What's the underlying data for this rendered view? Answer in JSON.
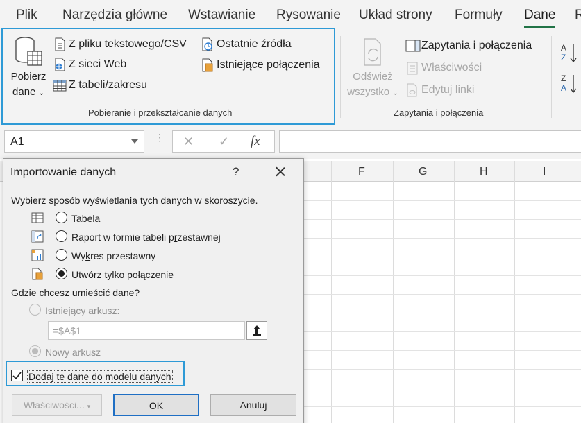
{
  "ribbon": {
    "tabs": [
      "Plik",
      "Narzędzia główne",
      "Wstawianie",
      "Rysowanie",
      "Układ strony",
      "Formuły",
      "Dane",
      "R"
    ],
    "active_tab": "Dane",
    "get_data_label_line1": "Pobierz",
    "get_data_label_line2": "dane",
    "get_group": {
      "items": [
        "Z pliku tekstowego/CSV",
        "Z sieci Web",
        "Z tabeli/zakresu",
        "Ostatnie źródła",
        "Istniejące połączenia"
      ],
      "label": "Pobieranie i przekształcanie danych"
    },
    "refresh_label_line1": "Odśwież",
    "refresh_label_line2": "wszystko",
    "queries_group": {
      "items": [
        "Zapytania i połączenia",
        "Właściwości",
        "Edytuj linki"
      ],
      "label": "Zapytania i połączenia"
    },
    "colors": {
      "accent": "#217346",
      "highlight": "#2e9ad6"
    }
  },
  "formula_bar": {
    "name_box": "A1",
    "fx": "fx",
    "cancel_icon": "✕",
    "enter_icon": "✓"
  },
  "grid": {
    "columns": [
      "F",
      "G",
      "H",
      "I"
    ]
  },
  "dialog": {
    "title": "Importowanie danych",
    "help": "?",
    "prompt": "Wybierz sposób wyświetlania tych danych w skoroszycie.",
    "view_options": [
      {
        "label": "Tabela",
        "checked": false
      },
      {
        "label": "Raport w formie tabeli przestawnej",
        "checked": false
      },
      {
        "label": "Wykres przestawny",
        "checked": false
      },
      {
        "label": "Utwórz tylko połączenie",
        "checked": true
      }
    ],
    "location_prompt": "Gdzie chcesz umieścić dane?",
    "existing_sheet": "Istniejący arkusz:",
    "reference": "=$A$1",
    "new_sheet": "Nowy arkusz",
    "add_to_model": "Dodaj te dane do modelu danych",
    "add_to_model_checked": true,
    "buttons": {
      "properties": "Właściwości...",
      "ok": "OK",
      "cancel": "Anuluj"
    }
  }
}
